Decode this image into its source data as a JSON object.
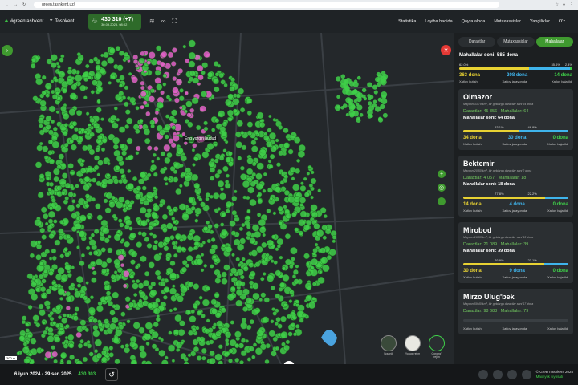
{
  "browser": {
    "url": "green.tashkent.uz/"
  },
  "header": {
    "brand": "#greentashkent",
    "city": "Toshkent",
    "count": "430 310 (+7)",
    "date": "30.09.2025, 08:02",
    "menu": [
      "Statistika",
      "Loyiha haqida",
      "Qayta aloqa",
      "Mutaxassislar",
      "Yangiliklar",
      "O'z"
    ]
  },
  "map": {
    "place_label": "Eng yorqin hudud",
    "scale": "300 m",
    "layers": [
      "Sputnik",
      "Yorug' rejim",
      "Qorong'i rejim"
    ]
  },
  "sidebar": {
    "tabs": [
      "Daraxtlar",
      "Mutaxassislar",
      "Mahallalar"
    ],
    "summary": {
      "total": "Mahallalar soni: 585 dona",
      "p1": "62.0%",
      "p2": "35.6%",
      "p3": "2.4%",
      "c1": "363 dona",
      "c2": "208 dona",
      "c3": "14 dona",
      "l1": "Xatlov kutish",
      "l2": "Xatlov jarayonida",
      "l3": "Xatlov bajarildi",
      "frac": [
        0.62,
        0.356,
        0.024
      ]
    },
    "cards": [
      {
        "name": "Olmazor",
        "desc": "Maydon 33.79 km², bir gektarga daraxtlar soni 34 dona",
        "trees": "Daraxtlar: 45 356",
        "mah": "Mahallalar: 64",
        "mahsoni": "Mahallalar soni: 64 dona",
        "p1": "53.1%",
        "p2": "46.9%",
        "c1": "34 dona",
        "c2": "30 dona",
        "c3": "0 dona",
        "frac": [
          0.531,
          0.469,
          0
        ]
      },
      {
        "name": "Bektemir",
        "desc": "Maydon 20.50 km², bir gektarga daraxtlar soni 2 dona",
        "trees": "Daraxtlar: 4 057",
        "mah": "Mahallalar: 18",
        "mahsoni": "Mahallalar soni: 18 dona",
        "p1": "77.8%",
        "p2": "22.2%",
        "c1": "14 dona",
        "c2": "4 dona",
        "c3": "0 dona",
        "frac": [
          0.778,
          0.222,
          0
        ]
      },
      {
        "name": "Mirobod",
        "desc": "Maydon 16.53 km², bir gektarga daraxtlar soni 13 dona",
        "trees": "Daraxtlar: 21 089",
        "mah": "Mahallalar: 39",
        "mahsoni": "Mahallalar soni: 39 dona",
        "p1": "76.9%",
        "p2": "23.1%",
        "c1": "30 dona",
        "c2": "9 dona",
        "c3": "0 dona",
        "frac": [
          0.769,
          0.231,
          0
        ]
      },
      {
        "name": "Mirzo Ulug'bek",
        "desc": "Maydon 59.40 km², bir gektarga daraxtlar soni 17 dona",
        "trees": "Daraxtlar: 98 683",
        "mah": "Mahallalar: 79",
        "mahsoni": "",
        "p1": "",
        "p2": "",
        "c1": "",
        "c2": "",
        "c3": "",
        "frac": [
          0,
          0,
          0
        ]
      }
    ],
    "labels": {
      "l1": "Xatlov kutish",
      "l2": "Xatlov jarayonida",
      "l3": "Xatlov bajarildi"
    }
  },
  "footer": {
    "range": "6 iyun 2024 - 29 sen 2025",
    "total": "430 303",
    "copyright": "© GreenTashkent 2025",
    "privacy": "Maxfiylik siyosati"
  },
  "colors": {
    "accent": "#3f9a2f",
    "tree": "#3fcf49",
    "pink": "#e262c8",
    "yellow": "#e8d233",
    "blue": "#3fb4ec"
  }
}
